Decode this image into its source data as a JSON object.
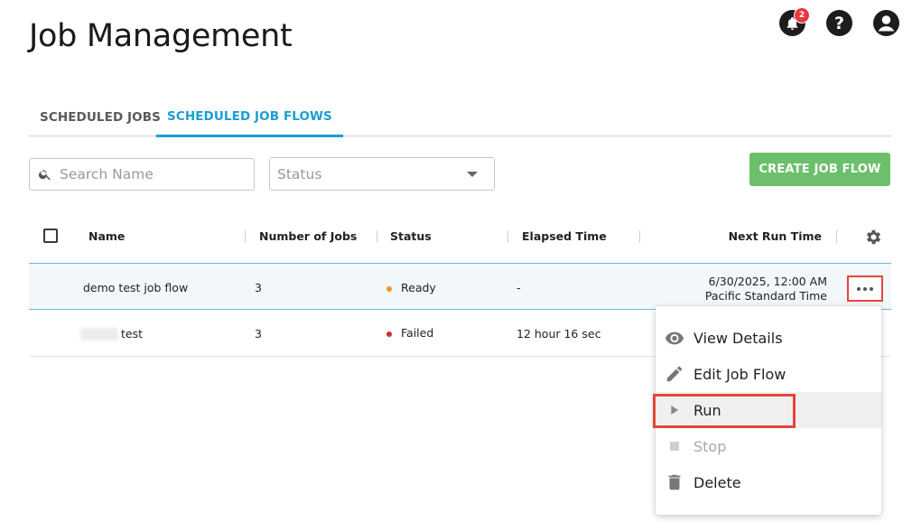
{
  "page": {
    "title": "Job Management"
  },
  "header": {
    "notification_count": "2",
    "help_glyph": "?"
  },
  "tabs": [
    {
      "label": "SCHEDULED JOBS",
      "active": false
    },
    {
      "label": "SCHEDULED JOB FLOWS",
      "active": true
    }
  ],
  "search": {
    "placeholder": "Search Name",
    "value": ""
  },
  "status_filter": {
    "placeholder": "Status"
  },
  "create_button": {
    "label": "CREATE JOB FLOW",
    "color": "#6cc06c"
  },
  "table": {
    "columns": [
      "Name",
      "Number of Jobs",
      "Status",
      "Elapsed Time",
      "Next Run Time"
    ],
    "rows": [
      {
        "name": "demo test job flow",
        "jobs": "3",
        "status": "Ready",
        "status_color": "#f5922f",
        "elapsed": "-",
        "next_run_line1": "6/30/2025, 12:00 AM",
        "next_run_line2": "Pacific Standard Time"
      },
      {
        "name": "test",
        "jobs": "3",
        "status": "Failed",
        "status_color": "#d9262f",
        "elapsed": "12 hour 16 sec",
        "next_run_line1": "",
        "next_run_line2": ""
      }
    ]
  },
  "context_menu": {
    "items": [
      {
        "label": "View Details",
        "icon": "eye-icon",
        "disabled": false
      },
      {
        "label": "Edit Job Flow",
        "icon": "pencil-icon",
        "disabled": false
      },
      {
        "label": "Run",
        "icon": "play-icon",
        "disabled": false
      },
      {
        "label": "Stop",
        "icon": "stop-icon",
        "disabled": true
      },
      {
        "label": "Delete",
        "icon": "trash-icon",
        "disabled": false
      }
    ]
  },
  "colors": {
    "accent": "#1a9ed4",
    "highlight_outline": "#e6463a"
  }
}
